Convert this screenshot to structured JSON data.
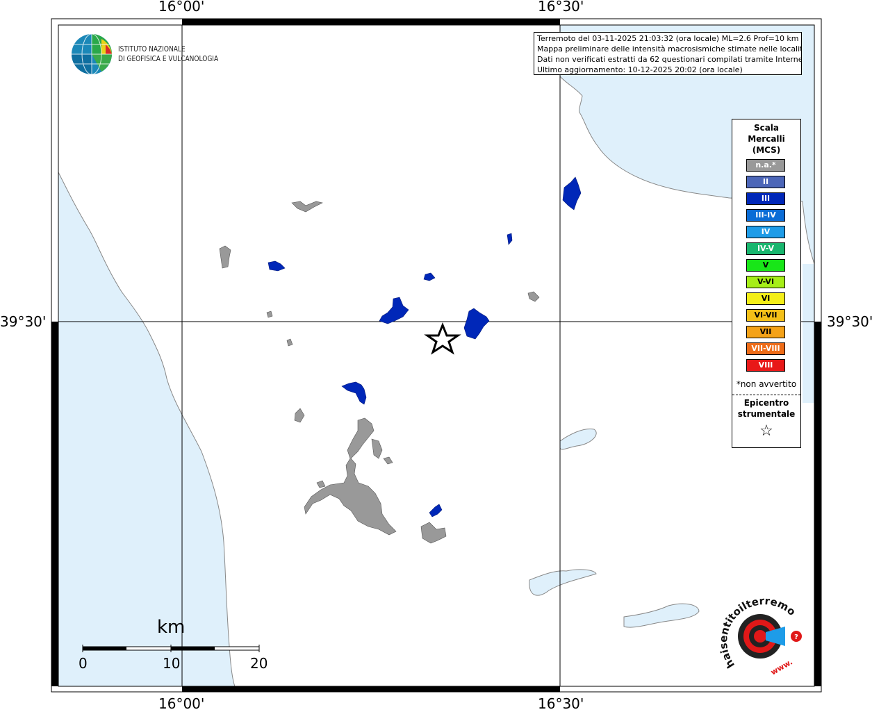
{
  "map": {
    "lon_labels": [
      "16°00'",
      "16°30'"
    ],
    "lat_label": "39°30'",
    "info_lines": [
      "Terremoto del 03-11-2025 21:03:32 (ora locale) ML=2.6 Prof=10 km",
      "Mappa preliminare delle intensità macrosismiche stimate nelle località",
      "Dati non verificati estratti da 62 questionari compilati tramite Internet.",
      "Ultimo aggiornamento: 10-12-2025 20:02 (ora locale)"
    ],
    "colors": {
      "sea": "#dff0fb",
      "coast": "#888888",
      "land": "#ffffff",
      "na": "#999999",
      "intensity_III": "#0027b8"
    }
  },
  "institute": {
    "line1": "ISTITUTO NAZIONALE",
    "line2": "DI GEOFISICA E VULCANOLOGIA"
  },
  "legend": {
    "title": "Scala\nMercalli\n(MCS)",
    "title_lines": [
      "Scala",
      "Mercalli",
      "(MCS)"
    ],
    "items": [
      {
        "label": "n.a.*",
        "color": "#999999"
      },
      {
        "label": "II",
        "color": "#4c66b8"
      },
      {
        "label": "III",
        "color": "#0027b8"
      },
      {
        "label": "III-IV",
        "color": "#0a6cd6"
      },
      {
        "label": "IV",
        "color": "#1e9ce8"
      },
      {
        "label": "IV-V",
        "color": "#18b66e"
      },
      {
        "label": "V",
        "color": "#18e618"
      },
      {
        "label": "V-VI",
        "color": "#a6ee18"
      },
      {
        "label": "VI",
        "color": "#f4ee18"
      },
      {
        "label": "VI-VII",
        "color": "#f4c018"
      },
      {
        "label": "VII",
        "color": "#f4a218"
      },
      {
        "label": "VII-VIII",
        "color": "#ee6c18"
      },
      {
        "label": "VIII",
        "color": "#e81818"
      }
    ],
    "note": "*non avvertito",
    "epicenter_line1": "Epicentro",
    "epicenter_line2": "strumentale",
    "star": "☆"
  },
  "scale_bar": {
    "unit": "km",
    "ticks": [
      "0",
      "10",
      "20"
    ]
  },
  "hsit_logo": {
    "text": "haisentitoilterremoto.it",
    "url_part": "www."
  }
}
